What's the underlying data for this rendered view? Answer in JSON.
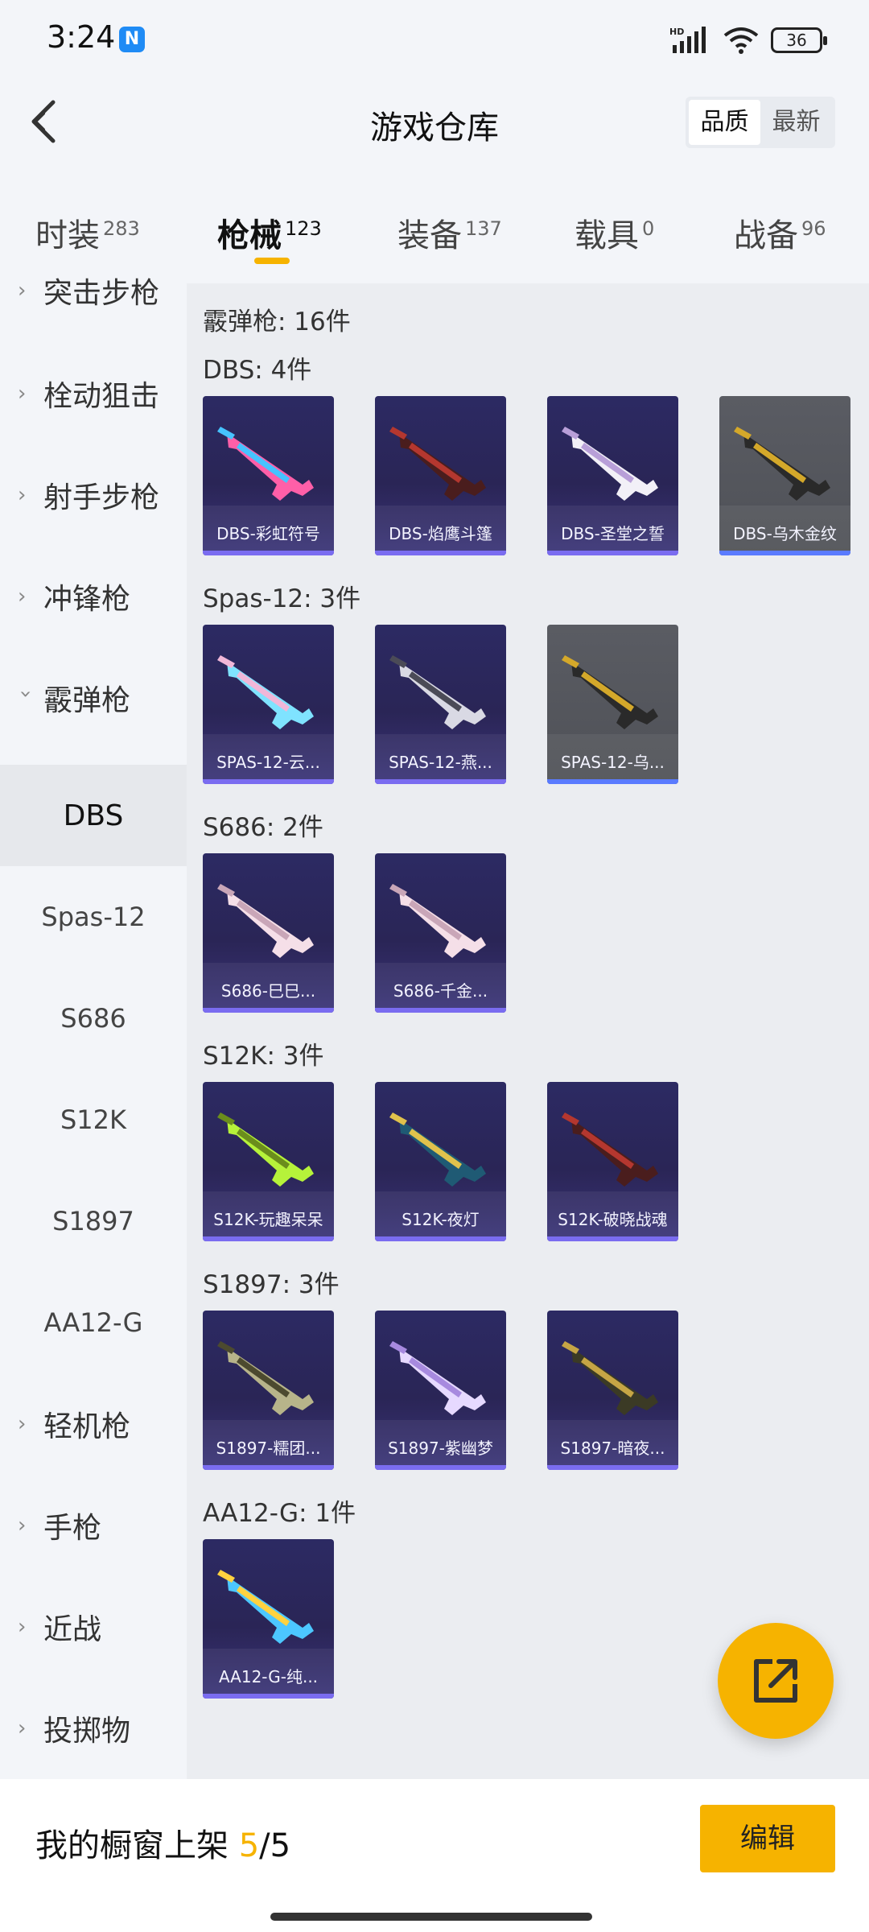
{
  "status_bar": {
    "time": "3:24",
    "nfc": "N",
    "battery": "36",
    "network": "HD"
  },
  "header": {
    "title": "游戏仓库",
    "sort_options": [
      "品质",
      "最新"
    ],
    "sort_selected": "品质"
  },
  "tabs": [
    {
      "label": "时装",
      "count": "283"
    },
    {
      "label": "枪械",
      "count": "123",
      "active": true
    },
    {
      "label": "装备",
      "count": "137"
    },
    {
      "label": "载具",
      "count": "0"
    },
    {
      "label": "战备",
      "count": "96"
    }
  ],
  "sidebar": {
    "categories": [
      {
        "label": "突击步枪"
      },
      {
        "label": "栓动狙击"
      },
      {
        "label": "射手步枪"
      },
      {
        "label": "冲锋枪"
      },
      {
        "label": "霰弹枪",
        "expanded": true
      },
      {
        "label": "轻机枪"
      },
      {
        "label": "手枪"
      },
      {
        "label": "近战"
      },
      {
        "label": "投掷物"
      }
    ],
    "subitems": [
      {
        "label": "DBS",
        "active": true
      },
      {
        "label": "Spas-12"
      },
      {
        "label": "S686"
      },
      {
        "label": "S12K"
      },
      {
        "label": "S1897"
      },
      {
        "label": "AA12-G"
      }
    ]
  },
  "main": {
    "section_title": "霰弹枪: 16件",
    "groups": [
      {
        "title": "DBS: 4件",
        "items": [
          {
            "name": "DBS-彩虹符号",
            "gun": "pink"
          },
          {
            "name": "DBS-焰鹰斗篷",
            "gun": "dark-red"
          },
          {
            "name": "DBS-圣堂之誓",
            "gun": "white"
          },
          {
            "name": "DBS-乌木金纹",
            "gun": "gold",
            "gray": true
          }
        ]
      },
      {
        "title": "Spas-12: 3件",
        "items": [
          {
            "name": "SPAS-12-云...",
            "gun": "cyan"
          },
          {
            "name": "SPAS-12-燕...",
            "gun": "silver"
          },
          {
            "name": "SPAS-12-乌...",
            "gun": "gold",
            "gray": true
          }
        ]
      },
      {
        "title": "S686: 2件",
        "items": [
          {
            "name": "S686-巳巳...",
            "gun": "pink-white"
          },
          {
            "name": "S686-千金...",
            "gun": "pink-white"
          }
        ]
      },
      {
        "title": "S12K: 3件",
        "items": [
          {
            "name": "S12K-玩趣呆呆",
            "gun": "lime"
          },
          {
            "name": "S12K-夜灯",
            "gun": "teal"
          },
          {
            "name": "S12K-破晓战魂",
            "gun": "dark-red"
          }
        ]
      },
      {
        "title": "S1897: 3件",
        "items": [
          {
            "name": "S1897-糯团...",
            "gun": "camo"
          },
          {
            "name": "S1897-紫幽梦",
            "gun": "lavender"
          },
          {
            "name": "S1897-暗夜...",
            "gun": "olive"
          }
        ]
      },
      {
        "title": "AA12-G: 1件",
        "items": [
          {
            "name": "AA12-G-纯...",
            "gun": "rainbow"
          }
        ]
      }
    ]
  },
  "bottom_bar": {
    "label_prefix": "我的橱窗上架 ",
    "count": "5",
    "total": "/5",
    "edit_label": "编辑"
  },
  "colors": {
    "accent": "#f6b300",
    "card_purple": "#2c2a63",
    "card_gray": "#55575d",
    "gun_colors": {
      "pink": [
        "#ff5fa8",
        "#46c3ff"
      ],
      "dark-red": [
        "#4a1d1d",
        "#b4372f"
      ],
      "white": [
        "#f2f0f7",
        "#b89fd8"
      ],
      "gold": [
        "#2a2a2a",
        "#d4a82a"
      ],
      "cyan": [
        "#7fe3ff",
        "#f1b7d8"
      ],
      "silver": [
        "#d9d9e4",
        "#4b4b57"
      ],
      "pink-white": [
        "#f5dfe8",
        "#c9a6b8"
      ],
      "lime": [
        "#b6f23a",
        "#6b8d1c"
      ],
      "teal": [
        "#1f5a74",
        "#e0c24c"
      ],
      "camo": [
        "#b7b48a",
        "#4c4a2f"
      ],
      "lavender": [
        "#e6d9ff",
        "#a78adf"
      ],
      "olive": [
        "#3b3a25",
        "#c6a545"
      ],
      "rainbow": [
        "#4cc7ff",
        "#ffd23f"
      ]
    }
  }
}
